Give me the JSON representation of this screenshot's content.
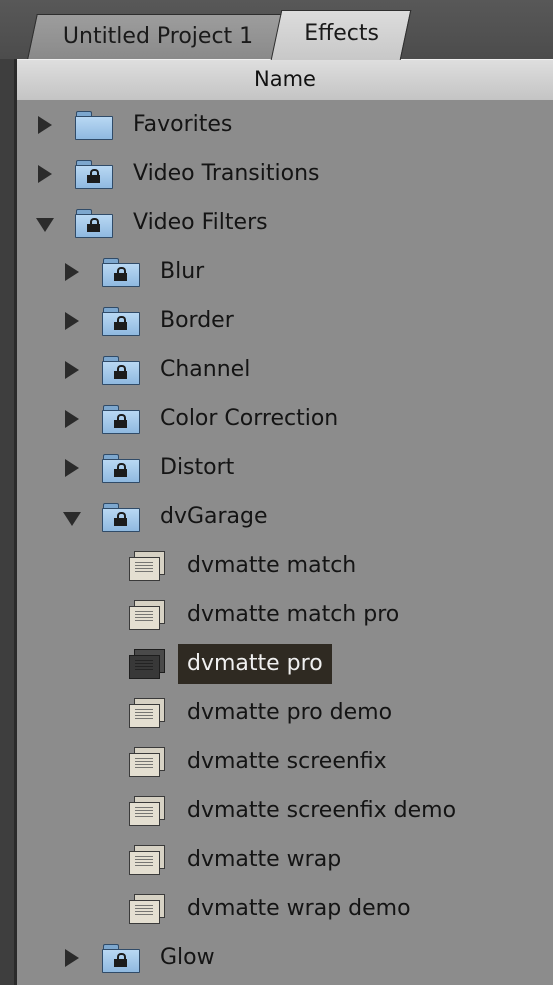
{
  "tabs": [
    {
      "label": "Untitled Project 1",
      "active": false
    },
    {
      "label": "Effects",
      "active": true
    }
  ],
  "column_header": "Name",
  "rows": [
    {
      "label": "Favorites",
      "type": "folder",
      "level": 0,
      "expanded": false,
      "locked": false
    },
    {
      "label": "Video Transitions",
      "type": "folder",
      "level": 0,
      "expanded": false,
      "locked": true
    },
    {
      "label": "Video Filters",
      "type": "folder",
      "level": 0,
      "expanded": true,
      "locked": true
    },
    {
      "label": "Blur",
      "type": "folder",
      "level": 1,
      "expanded": false,
      "locked": true
    },
    {
      "label": "Border",
      "type": "folder",
      "level": 1,
      "expanded": false,
      "locked": true
    },
    {
      "label": "Channel",
      "type": "folder",
      "level": 1,
      "expanded": false,
      "locked": true
    },
    {
      "label": "Color Correction",
      "type": "folder",
      "level": 1,
      "expanded": false,
      "locked": true
    },
    {
      "label": "Distort",
      "type": "folder",
      "level": 1,
      "expanded": false,
      "locked": true
    },
    {
      "label": "dvGarage",
      "type": "folder",
      "level": 1,
      "expanded": true,
      "locked": true
    },
    {
      "label": "dvmatte match",
      "type": "filter",
      "level": 2,
      "selected": false
    },
    {
      "label": "dvmatte match pro",
      "type": "filter",
      "level": 2,
      "selected": false
    },
    {
      "label": "dvmatte pro",
      "type": "filter",
      "level": 2,
      "selected": true
    },
    {
      "label": "dvmatte pro demo",
      "type": "filter",
      "level": 2,
      "selected": false
    },
    {
      "label": "dvmatte screenfix",
      "type": "filter",
      "level": 2,
      "selected": false
    },
    {
      "label": "dvmatte screenfix demo",
      "type": "filter",
      "level": 2,
      "selected": false
    },
    {
      "label": "dvmatte wrap",
      "type": "filter",
      "level": 2,
      "selected": false
    },
    {
      "label": "dvmatte wrap demo",
      "type": "filter",
      "level": 2,
      "selected": false
    },
    {
      "label": "Glow",
      "type": "folder",
      "level": 1,
      "expanded": false,
      "locked": true
    }
  ],
  "icons": {
    "folder": "folder-icon",
    "locked_folder": "locked-folder-icon",
    "filter": "video-filter-icon",
    "collapsed": "disclosure-right-icon",
    "expanded": "disclosure-down-icon"
  },
  "colors": {
    "list_background": "#8c8c8c",
    "selection": "#2f2a22",
    "folder_blue": "#9fc4e8"
  }
}
